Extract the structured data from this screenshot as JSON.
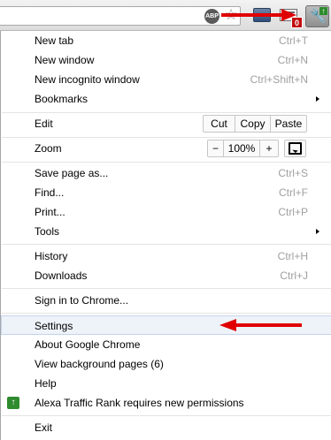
{
  "toolbar": {
    "abp_label": "ABP",
    "badge_count": "0",
    "icons": [
      "abp-icon",
      "bookmark-star-icon",
      "extension-icon",
      "mail-extension-icon",
      "wrench-icon",
      "update-available-icon"
    ]
  },
  "menu": {
    "new_tab": {
      "label": "New tab",
      "accel": "Ctrl+T"
    },
    "new_window": {
      "label": "New window",
      "accel": "Ctrl+N"
    },
    "new_incognito": {
      "label": "New incognito window",
      "accel": "Ctrl+Shift+N"
    },
    "bookmarks": {
      "label": "Bookmarks"
    },
    "edit": {
      "label": "Edit",
      "cut": "Cut",
      "copy": "Copy",
      "paste": "Paste"
    },
    "zoom": {
      "label": "Zoom",
      "minus": "−",
      "value": "100%",
      "plus": "+"
    },
    "save_page": {
      "label": "Save page as...",
      "accel": "Ctrl+S"
    },
    "find": {
      "label": "Find...",
      "accel": "Ctrl+F"
    },
    "print": {
      "label": "Print...",
      "accel": "Ctrl+P"
    },
    "tools": {
      "label": "Tools"
    },
    "history": {
      "label": "History",
      "accel": "Ctrl+H"
    },
    "downloads": {
      "label": "Downloads",
      "accel": "Ctrl+J"
    },
    "sign_in": {
      "label": "Sign in to Chrome..."
    },
    "settings": {
      "label": "Settings"
    },
    "about": {
      "label": "About Google Chrome"
    },
    "background_pages": {
      "label": "View background pages (6)"
    },
    "help": {
      "label": "Help"
    },
    "alexa": {
      "label": "Alexa Traffic Rank requires new permissions"
    },
    "exit": {
      "label": "Exit"
    }
  },
  "colors": {
    "annotation_arrow": "#e00000",
    "highlight_bg": "#eef3fa",
    "accelerator_text": "#a0a0a0",
    "update_green": "#2e8b2e",
    "badge_red": "#c20d0d"
  }
}
